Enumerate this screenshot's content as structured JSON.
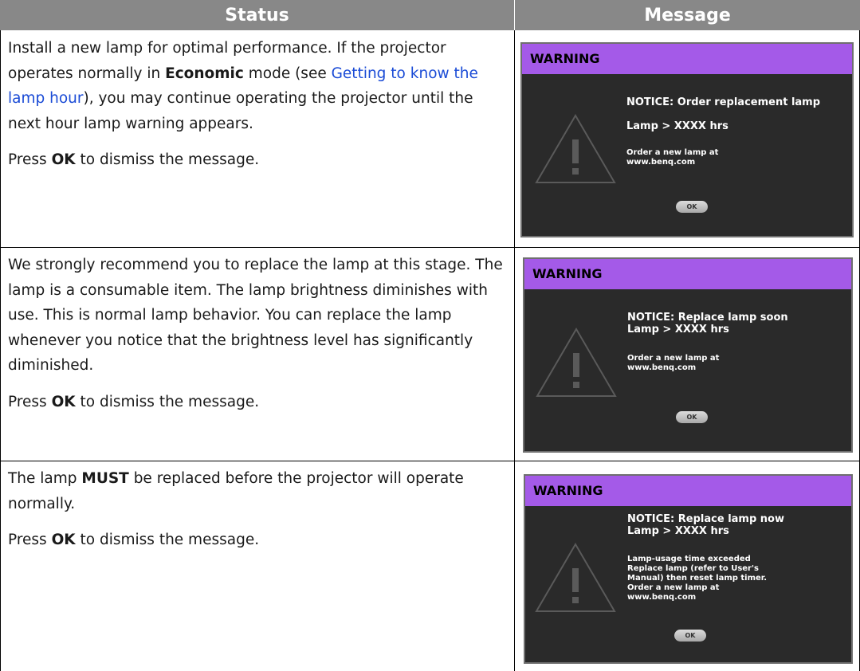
{
  "header": {
    "status": "Status",
    "message": "Message"
  },
  "rows": [
    {
      "status_line1_pre": "Install a new lamp for optimal performance. If the projector operates normally in ",
      "status_line1_bold": "Economic",
      "status_line1_mid": " mode (see ",
      "status_link": "Getting to know the lamp hour",
      "status_line1_post": "), you may continue operating the projector until the next hour lamp warning appears.",
      "dismiss_pre": "Press ",
      "dismiss_bold": "OK",
      "dismiss_post": " to dismiss the message.",
      "osd": {
        "title": "WARNING",
        "notice": "NOTICE: Order replacement lamp",
        "hours": "Lamp > XXXX hrs",
        "detail": "Order a new lamp at www.benq.com",
        "ok": "OK"
      }
    },
    {
      "status_text": "We strongly recommend you to replace the lamp at this stage. The lamp is a consumable item. The lamp brightness diminishes with use. This is normal lamp behavior. You can replace the lamp whenever you notice that the brightness level has significantly diminished.",
      "dismiss_pre": "Press ",
      "dismiss_bold": "OK",
      "dismiss_post": " to dismiss the message.",
      "osd": {
        "title": "WARNING",
        "notice": "NOTICE: Replace lamp soon",
        "hours": "Lamp > XXXX hrs",
        "detail": "Order a new lamp at www.benq.com",
        "ok": "OK"
      }
    },
    {
      "status_pre": "The lamp ",
      "status_bold": "MUST",
      "status_post": " be replaced before the projector will operate normally.",
      "dismiss_pre": "Press ",
      "dismiss_bold": "OK",
      "dismiss_post": " to dismiss the message.",
      "osd": {
        "title": "WARNING",
        "notice": "NOTICE: Replace lamp now",
        "hours": "Lamp > XXXX hrs",
        "detail_1": "Lamp-usage time exceeded",
        "detail_2": "Replace lamp (refer to User's Manual) then reset lamp timer.",
        "detail_3": "Order a new lamp at www.benq.com",
        "ok": "OK"
      }
    }
  ]
}
